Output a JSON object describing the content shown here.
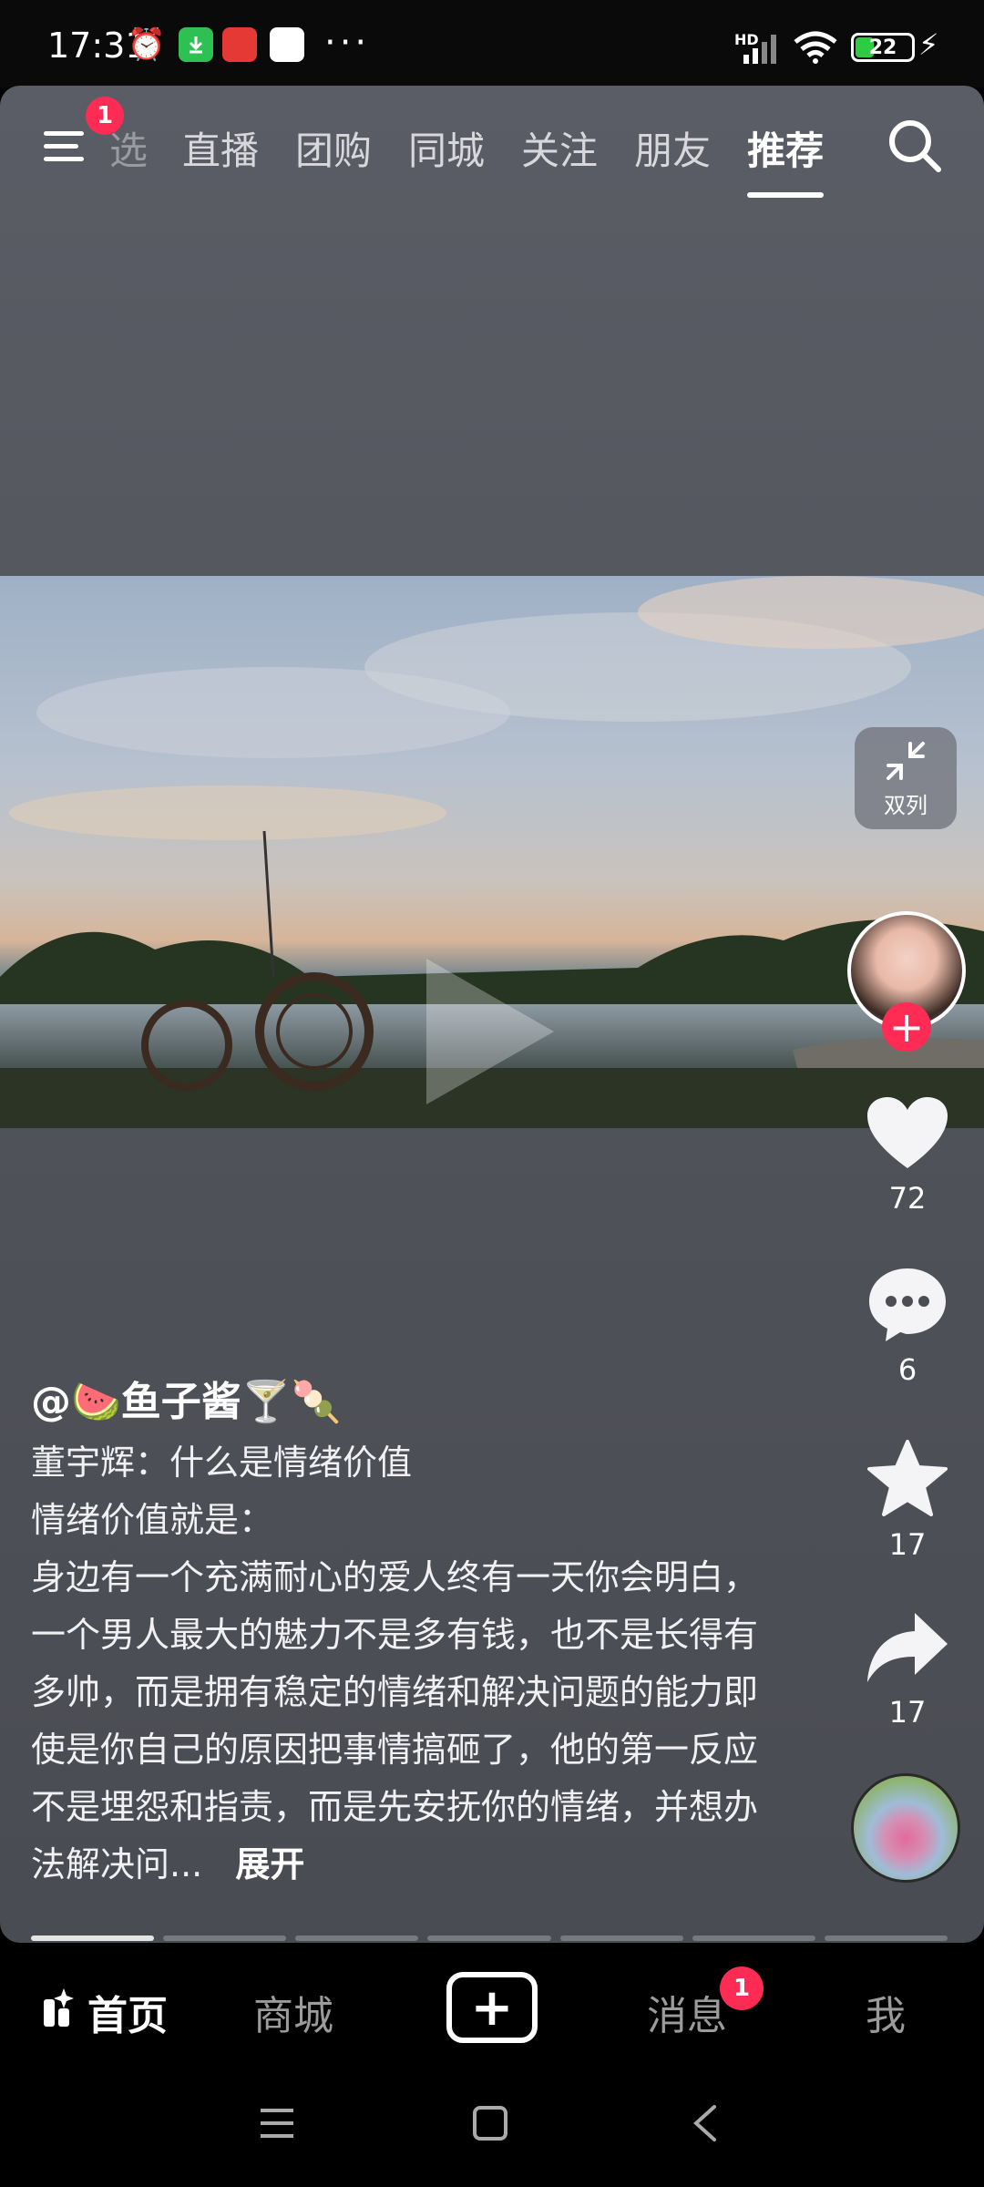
{
  "status": {
    "time": "17:31",
    "hd": "HD",
    "battery": "22",
    "more": "···"
  },
  "topnav": {
    "menu_badge": "1",
    "tabs": [
      {
        "label": "选"
      },
      {
        "label": "直播"
      },
      {
        "label": "团购"
      },
      {
        "label": "同城"
      },
      {
        "label": "关注"
      },
      {
        "label": "朋友"
      },
      {
        "label": "推荐"
      }
    ]
  },
  "side": {
    "dual_label": "双列",
    "likes": "72",
    "comments": "6",
    "favorites": "17",
    "shares": "17"
  },
  "post": {
    "author": "@🍉鱼子酱🍸🍡",
    "lines": [
      "董宇辉：什么是情绪价值",
      "情绪价值就是：",
      "身边有一个充满耐心的爱人终有一天你会明白，一个男人最大的魅力不是多有钱，也不是长得有多帅，而是拥有稳定的情绪和解决问题的能力即使是你自己的原因把事情搞砸了，他的第一反应不是埋怨和指责，而是先安抚你的情绪，并想办法解决问..."
    ],
    "expand": "展开"
  },
  "bottomnav": {
    "home": "首页",
    "mall": "商城",
    "messages": "消息",
    "messages_badge": "1",
    "me": "我"
  },
  "colors": {
    "accent": "#fe2c55",
    "card_bg": "#52545b"
  }
}
